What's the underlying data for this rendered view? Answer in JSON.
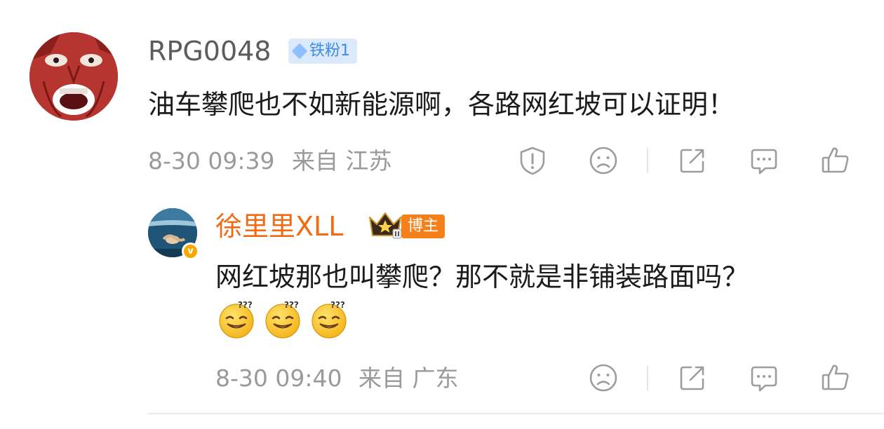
{
  "comment": {
    "author": "RPG0048",
    "fan_badge": "铁粉1",
    "text": "油车攀爬也不如新能源啊，各路网红坡可以证明！",
    "time": "8-30 09:39",
    "location": "来自 江苏"
  },
  "reply": {
    "author": "徐里里XLL",
    "role_badge": "博主",
    "text": "网红坡那也叫攀爬？那不就是非铺装路面吗？",
    "time": "8-30 09:40",
    "location": "来自 广东",
    "verified_mark": "v"
  },
  "icons": {
    "report": "report-icon",
    "dislike": "dislike-face-icon",
    "share": "share-icon",
    "comment": "comment-icon",
    "like": "thumbs-up-icon",
    "emoji": "dizzy-smile-emoji"
  },
  "colors": {
    "orange_username": "#f06b13",
    "fan_badge_bg": "#dbe9fb",
    "fan_badge_text": "#3b8ce5",
    "blogger_badge_bg": "#f5801a",
    "meta_text": "#9a9a9a",
    "icon_stroke": "#9d9d9d"
  }
}
